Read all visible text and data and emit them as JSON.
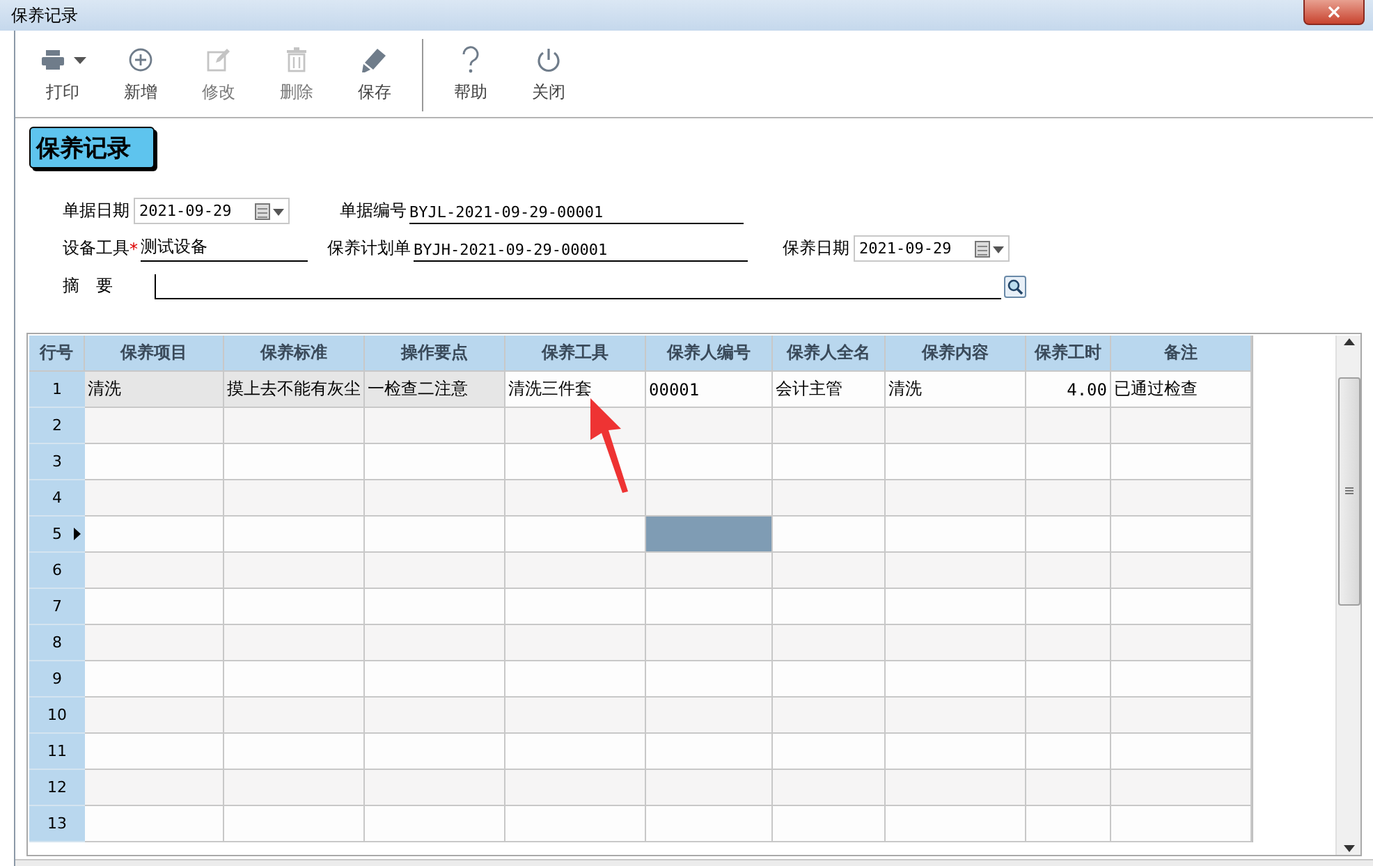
{
  "window": {
    "title": "保养记录",
    "close": "×"
  },
  "toolbar": [
    {
      "kind": "print",
      "label": "打印",
      "disabled": false,
      "dropdown": true
    },
    {
      "kind": "add",
      "label": "新增",
      "disabled": false,
      "dropdown": false
    },
    {
      "kind": "edit",
      "label": "修改",
      "disabled": true,
      "dropdown": false
    },
    {
      "kind": "delete",
      "label": "删除",
      "disabled": true,
      "dropdown": false
    },
    {
      "kind": "save",
      "label": "保存",
      "disabled": false,
      "dropdown": false
    },
    {
      "kind": "help",
      "label": "帮助",
      "disabled": false,
      "dropdown": false,
      "separator_before": true
    },
    {
      "kind": "power",
      "label": "关闭",
      "disabled": false,
      "dropdown": false
    }
  ],
  "heading": "保养记录",
  "form": {
    "doc_date": {
      "label": "单据日期",
      "value": "2021-09-29"
    },
    "doc_number": {
      "label": "单据编号",
      "value": "BYJL-2021-09-29-00001"
    },
    "equipment": {
      "label": "设备工具",
      "required_mark": "*",
      "value": "测试设备"
    },
    "plan": {
      "label": "保养计划单",
      "value": "BYJH-2021-09-29-00001"
    },
    "maint_date": {
      "label": "保养日期",
      "value": "2021-09-29"
    },
    "summary": {
      "label": "摘　要"
    }
  },
  "grid": {
    "columns": [
      "行号",
      "保养项目",
      "保养标准",
      "操作要点",
      "保养工具",
      "保养人编号",
      "保养人全名",
      "保养内容",
      "保养工时",
      "备注"
    ],
    "rows": [
      {
        "current": false,
        "cells": [
          {
            "text": "1",
            "selected": false,
            "locked": false
          },
          {
            "text": "清洗",
            "selected": false,
            "locked": true
          },
          {
            "text": "摸上去不能有灰尘",
            "selected": false,
            "locked": true
          },
          {
            "text": "一检查二注意",
            "selected": false,
            "locked": true
          },
          {
            "text": "清洗三件套",
            "selected": false,
            "locked": false
          },
          {
            "text": "00001",
            "selected": false,
            "locked": false
          },
          {
            "text": "会计主管",
            "selected": false,
            "locked": false
          },
          {
            "text": "清洗",
            "selected": false,
            "locked": false
          },
          {
            "text": "4.00",
            "selected": false,
            "locked": false
          },
          {
            "text": "已通过检查",
            "selected": false,
            "locked": false
          }
        ]
      },
      {
        "current": false,
        "cells": [
          {
            "text": "2",
            "selected": false
          },
          {
            "selected": false
          },
          {
            "selected": false
          },
          {
            "selected": false
          },
          {
            "selected": false
          },
          {
            "selected": false
          },
          {
            "selected": false
          },
          {
            "selected": false
          },
          {
            "selected": false
          },
          {
            "selected": false
          }
        ]
      },
      {
        "current": false,
        "cells": [
          {
            "text": "3",
            "selected": false
          },
          {
            "selected": false
          },
          {
            "selected": false
          },
          {
            "selected": false
          },
          {
            "selected": false
          },
          {
            "selected": false
          },
          {
            "selected": false
          },
          {
            "selected": false
          },
          {
            "selected": false
          },
          {
            "selected": false
          }
        ]
      },
      {
        "current": false,
        "cells": [
          {
            "text": "4",
            "selected": false
          },
          {
            "selected": false
          },
          {
            "selected": false
          },
          {
            "selected": false
          },
          {
            "selected": false
          },
          {
            "selected": false
          },
          {
            "selected": false
          },
          {
            "selected": false
          },
          {
            "selected": false
          },
          {
            "selected": false
          }
        ]
      },
      {
        "current": true,
        "cells": [
          {
            "text": "5",
            "selected": false
          },
          {
            "selected": false
          },
          {
            "selected": false
          },
          {
            "selected": false
          },
          {
            "selected": false
          },
          {
            "selected": true
          },
          {
            "selected": false
          },
          {
            "selected": false
          },
          {
            "selected": false
          },
          {
            "selected": false
          }
        ]
      },
      {
        "current": false,
        "cells": [
          {
            "text": "6",
            "selected": false
          },
          {
            "selected": false
          },
          {
            "selected": false
          },
          {
            "selected": false
          },
          {
            "selected": false
          },
          {
            "selected": false
          },
          {
            "selected": false
          },
          {
            "selected": false
          },
          {
            "selected": false
          },
          {
            "selected": false
          }
        ]
      },
      {
        "current": false,
        "cells": [
          {
            "text": "7",
            "selected": false
          },
          {
            "selected": false
          },
          {
            "selected": false
          },
          {
            "selected": false
          },
          {
            "selected": false
          },
          {
            "selected": false
          },
          {
            "selected": false
          },
          {
            "selected": false
          },
          {
            "selected": false
          },
          {
            "selected": false
          }
        ]
      },
      {
        "current": false,
        "cells": [
          {
            "text": "8",
            "selected": false
          },
          {
            "selected": false
          },
          {
            "selected": false
          },
          {
            "selected": false
          },
          {
            "selected": false
          },
          {
            "selected": false
          },
          {
            "selected": false
          },
          {
            "selected": false
          },
          {
            "selected": false
          },
          {
            "selected": false
          }
        ]
      },
      {
        "current": false,
        "cells": [
          {
            "text": "9",
            "selected": false
          },
          {
            "selected": false
          },
          {
            "selected": false
          },
          {
            "selected": false
          },
          {
            "selected": false
          },
          {
            "selected": false
          },
          {
            "selected": false
          },
          {
            "selected": false
          },
          {
            "selected": false
          },
          {
            "selected": false
          }
        ]
      },
      {
        "current": false,
        "cells": [
          {
            "text": "10",
            "selected": false
          },
          {
            "selected": false
          },
          {
            "selected": false
          },
          {
            "selected": false
          },
          {
            "selected": false
          },
          {
            "selected": false
          },
          {
            "selected": false
          },
          {
            "selected": false
          },
          {
            "selected": false
          },
          {
            "selected": false
          }
        ]
      },
      {
        "current": false,
        "cells": [
          {
            "text": "11",
            "selected": false
          },
          {
            "selected": false
          },
          {
            "selected": false
          },
          {
            "selected": false
          },
          {
            "selected": false
          },
          {
            "selected": false
          },
          {
            "selected": false
          },
          {
            "selected": false
          },
          {
            "selected": false
          },
          {
            "selected": false
          }
        ]
      },
      {
        "current": false,
        "cells": [
          {
            "text": "12",
            "selected": false
          },
          {
            "selected": false
          },
          {
            "selected": false
          },
          {
            "selected": false
          },
          {
            "selected": false
          },
          {
            "selected": false
          },
          {
            "selected": false
          },
          {
            "selected": false
          },
          {
            "selected": false
          },
          {
            "selected": false
          }
        ]
      },
      {
        "current": false,
        "cells": [
          {
            "text": "13",
            "selected": false
          },
          {
            "selected": false
          },
          {
            "selected": false
          },
          {
            "selected": false
          },
          {
            "selected": false
          },
          {
            "selected": false
          },
          {
            "selected": false
          },
          {
            "selected": false
          },
          {
            "selected": false
          },
          {
            "selected": false
          }
        ]
      }
    ]
  }
}
